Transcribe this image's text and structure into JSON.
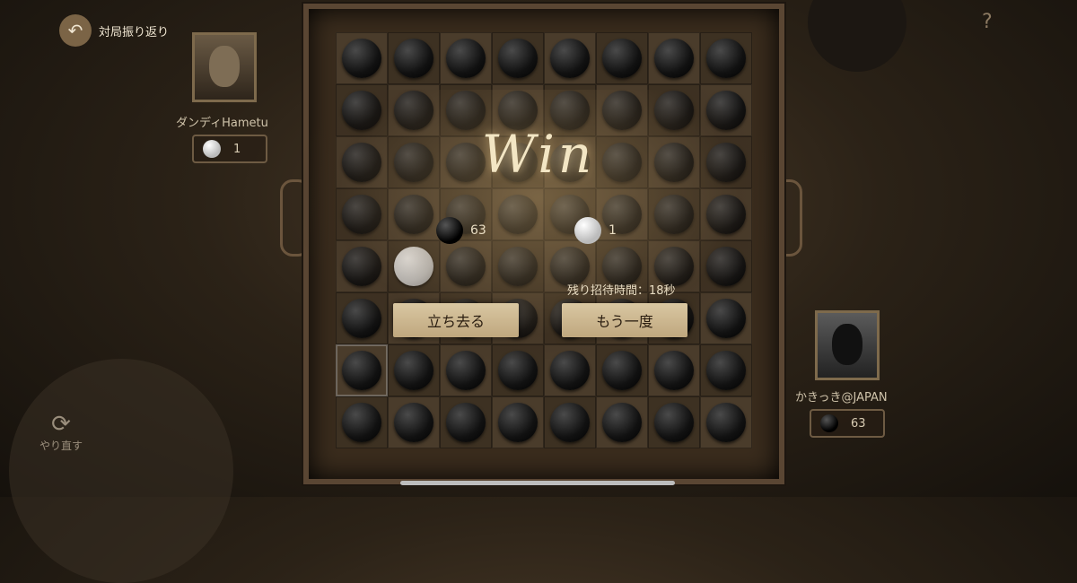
{
  "header": {
    "back_label": "対局振り返り",
    "back_icon": "back-arrow-icon"
  },
  "player_top": {
    "name": "ダンディHametu",
    "stone": "white",
    "count": "1"
  },
  "player_bottom": {
    "name": "かきっき@JAPAN",
    "stone": "black",
    "count": "63"
  },
  "result": {
    "title": "Win",
    "black_score": "63",
    "white_score": "1",
    "timer": "残り招待時間：18秒",
    "leave_label": "立ち去る",
    "rematch_label": "もう一度"
  },
  "redo": {
    "label": "やり直す",
    "icon": "refresh-icon"
  },
  "help_icon": "question-book-icon",
  "board": {
    "rows": 8,
    "cols": 8,
    "cells": [
      "bbbbbbbb",
      "bbbbbbbb",
      "bbbbbbbb",
      "bbbbbbbb",
      "bwbbbbbb",
      "bbbbbbbb",
      "bbbbbbbb",
      "bbbbbbbb"
    ],
    "highlight": [
      6,
      0
    ]
  },
  "colors": {
    "accent": "#f3e6c4",
    "button": "#cdb890",
    "frame": "#5a4633"
  }
}
